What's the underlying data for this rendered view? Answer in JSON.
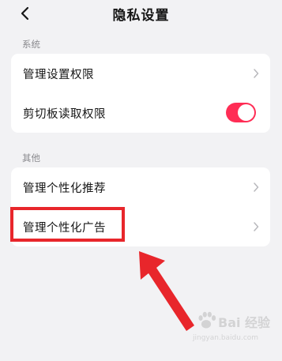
{
  "header": {
    "title": "隐私设置",
    "back_icon": "chevron-left-icon"
  },
  "system": {
    "section_label": "系统",
    "items": [
      {
        "label": "管理设置权限",
        "control": "chevron"
      },
      {
        "label": "剪切板读取权限",
        "control": "toggle",
        "enabled": true
      }
    ]
  },
  "other": {
    "section_label": "其他",
    "items": [
      {
        "label": "管理个性化推荐",
        "control": "chevron"
      },
      {
        "label": "管理个性化广告",
        "control": "chevron"
      }
    ]
  },
  "annotation": {
    "highlight_color": "#e8262b",
    "arrow_color": "#e8262b"
  },
  "watermark": {
    "text": "Bai 经验",
    "url": "jingyan.baidu.com"
  },
  "colors": {
    "background": "#f2f2f4",
    "toggle_on": "#ff2d55"
  }
}
